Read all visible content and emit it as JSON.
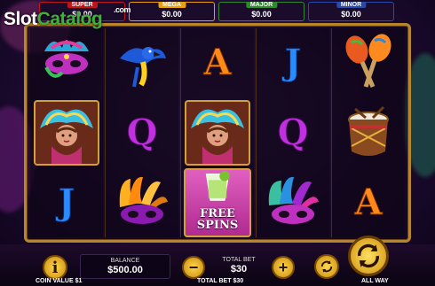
{
  "watermark": {
    "slot": "Slot",
    "catalog": "Catalog",
    "com": ".com"
  },
  "jackpots": [
    {
      "name": "SUPER",
      "value": "$0.00"
    },
    {
      "name": "MEGA",
      "value": "$0.00"
    },
    {
      "name": "MAJOR",
      "value": "$0.00"
    },
    {
      "name": "MINOR",
      "value": "$0.00"
    }
  ],
  "reels": [
    [
      "carnival-mask-icon",
      "carnival-dancer-icon",
      "J"
    ],
    [
      "parrot-icon",
      "Q",
      "feather-mask-icon"
    ],
    [
      "A",
      "carnival-dancer-icon",
      "free-spins"
    ],
    [
      "J",
      "Q",
      "feather-mask-icon"
    ],
    [
      "maracas-icon",
      "drum-icon",
      "A"
    ]
  ],
  "free_spins": {
    "line1": "FREE",
    "line2": "SPINS"
  },
  "controls": {
    "info_label": "i",
    "coin_value": "COIN VALUE $1",
    "balance_label": "BALANCE",
    "balance_value": "$500.00",
    "total_bet_label": "TOTAL BET",
    "total_bet_value": "$30",
    "total_bet_footer": "TOTAL BET $30",
    "minus_label": "−",
    "plus_label": "+",
    "all_way": "ALL WAY"
  },
  "colors": {
    "frame_gold": "#b8862a",
    "super": "#c0141c",
    "mega": "#e8a010",
    "major": "#2e8a2a",
    "minor": "#2a4aa8"
  }
}
